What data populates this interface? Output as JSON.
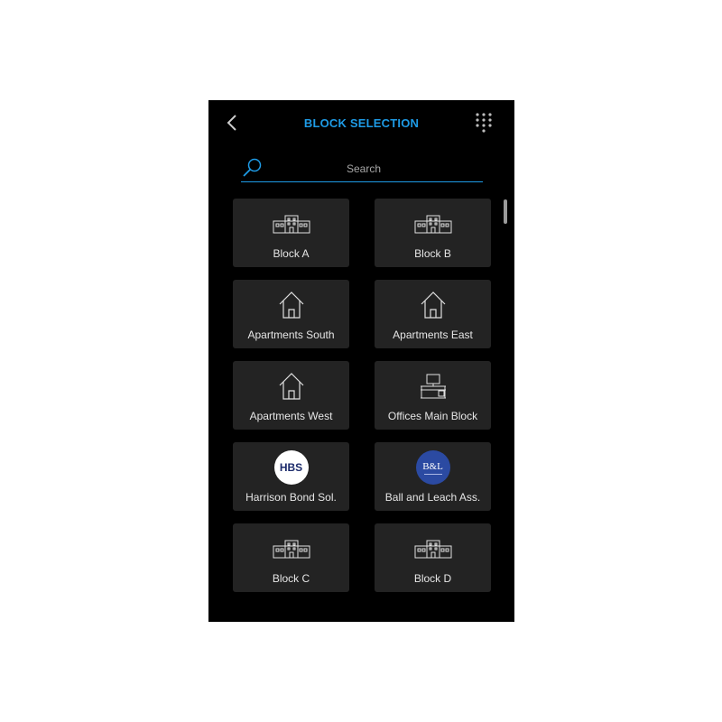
{
  "header": {
    "title": "BLOCK SELECTION",
    "back_icon": "chevron-left-icon",
    "keypad_icon": "dial-pad-icon",
    "accent_color": "#1e9be6"
  },
  "search": {
    "placeholder": "Search",
    "value": ""
  },
  "blocks": [
    {
      "label": "Block A",
      "icon": "building-icon"
    },
    {
      "label": "Block B",
      "icon": "building-icon"
    },
    {
      "label": "Apartments South",
      "icon": "house-icon"
    },
    {
      "label": "Apartments East",
      "icon": "house-icon"
    },
    {
      "label": "Apartments West",
      "icon": "house-icon"
    },
    {
      "label": "Offices Main Block",
      "icon": "office-desk-icon"
    },
    {
      "label": "Harrison Bond Sol.",
      "icon": "hbs-logo",
      "logo_text": "HBS"
    },
    {
      "label": "Ball and Leach Ass.",
      "icon": "bl-logo",
      "logo_text": "B&L"
    },
    {
      "label": "Block C",
      "icon": "building-icon"
    },
    {
      "label": "Block D",
      "icon": "building-icon"
    }
  ]
}
